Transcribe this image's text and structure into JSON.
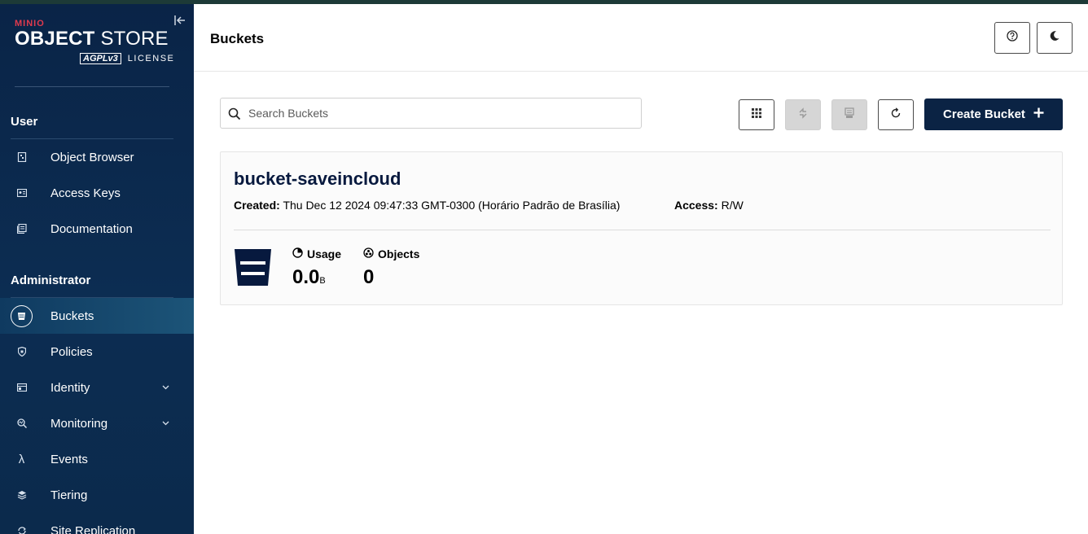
{
  "sidebar": {
    "logo": {
      "brand": "MINIO",
      "product_bold": "OBJECT",
      "product_light": "STORE",
      "agpl": "AGPLv3",
      "license": "LICENSE"
    },
    "sections": {
      "user": "User",
      "administrator": "Administrator"
    },
    "user_items": [
      {
        "label": "Object Browser",
        "icon": "object-browser-icon"
      },
      {
        "label": "Access Keys",
        "icon": "access-keys-icon"
      },
      {
        "label": "Documentation",
        "icon": "documentation-icon"
      }
    ],
    "admin_items": [
      {
        "label": "Buckets",
        "icon": "bucket-icon",
        "active": true
      },
      {
        "label": "Policies",
        "icon": "shield-icon"
      },
      {
        "label": "Identity",
        "icon": "identity-icon",
        "expandable": true
      },
      {
        "label": "Monitoring",
        "icon": "monitoring-icon",
        "expandable": true
      },
      {
        "label": "Events",
        "icon": "lambda-icon",
        "glyph": "λ"
      },
      {
        "label": "Tiering",
        "icon": "layers-icon"
      },
      {
        "label": "Site Replication",
        "icon": "replication-icon"
      }
    ]
  },
  "header": {
    "title": "Buckets"
  },
  "toolbar": {
    "search_placeholder": "Search Buckets",
    "create_label": "Create Bucket"
  },
  "buckets": [
    {
      "name": "bucket-saveincloud",
      "created_label": "Created:",
      "created_value": "Thu Dec 12 2024 09:47:33 GMT-0300 (Horário Padrão de Brasília)",
      "access_label": "Access:",
      "access_value": "R/W",
      "usage_label": "Usage",
      "usage_value": "0.0",
      "usage_unit": "B",
      "objects_label": "Objects",
      "objects_value": "0"
    }
  ],
  "colors": {
    "sidebar": "#0a2447",
    "primary": "#0b2344",
    "active_nav": "#1c5478",
    "brand_red": "#e03a4e"
  }
}
